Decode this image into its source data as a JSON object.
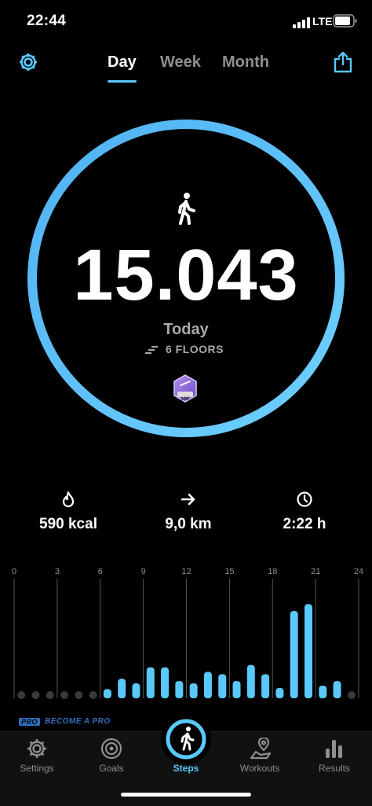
{
  "status_bar": {
    "time": "22:44",
    "network": "LTE"
  },
  "header": {
    "tabs": [
      {
        "label": "Day",
        "active": true
      },
      {
        "label": "Week",
        "active": false
      },
      {
        "label": "Month",
        "active": false
      }
    ],
    "settings_icon": "gear-icon",
    "share_icon": "share-icon"
  },
  "summary": {
    "steps": "15.043",
    "period": "Today",
    "floors": "6 FLOORS",
    "goal_progress": 1.0,
    "badge_text": "10K"
  },
  "stats": {
    "calories": "590 kcal",
    "distance": "9,0 km",
    "duration": "2:22 h"
  },
  "chart_data": {
    "type": "bar",
    "x_ticks": [
      "0",
      "3",
      "6",
      "9",
      "12",
      "15",
      "18",
      "21",
      "24"
    ],
    "hours": [
      0,
      1,
      2,
      3,
      4,
      5,
      6,
      7,
      8,
      9,
      10,
      11,
      12,
      13,
      14,
      15,
      16,
      17,
      18,
      19,
      20,
      21,
      22,
      23
    ],
    "values": [
      0,
      0,
      0,
      0,
      0,
      0,
      0.08,
      0.17,
      0.13,
      0.27,
      0.27,
      0.15,
      0.13,
      0.23,
      0.21,
      0.15,
      0.29,
      0.21,
      0.09,
      0.76,
      0.82,
      0.11,
      0.15,
      0
    ],
    "ylim": [
      0,
      1
    ],
    "color": "#5ac8fa",
    "grid": true
  },
  "promo": {
    "tag": "PRO",
    "text": "BECOME A PRO"
  },
  "tabbar": {
    "items": [
      {
        "label": "Settings",
        "icon": "gear-icon",
        "active": false
      },
      {
        "label": "Goals",
        "icon": "target-icon",
        "active": false
      },
      {
        "label": "Steps",
        "icon": "walker-icon",
        "active": true
      },
      {
        "label": "Workouts",
        "icon": "map-pin-icon",
        "active": false
      },
      {
        "label": "Results",
        "icon": "bar-chart-icon",
        "active": false
      }
    ]
  },
  "colors": {
    "accent": "#5ac8fa",
    "background": "#000000",
    "muted": "#8e8e93"
  }
}
